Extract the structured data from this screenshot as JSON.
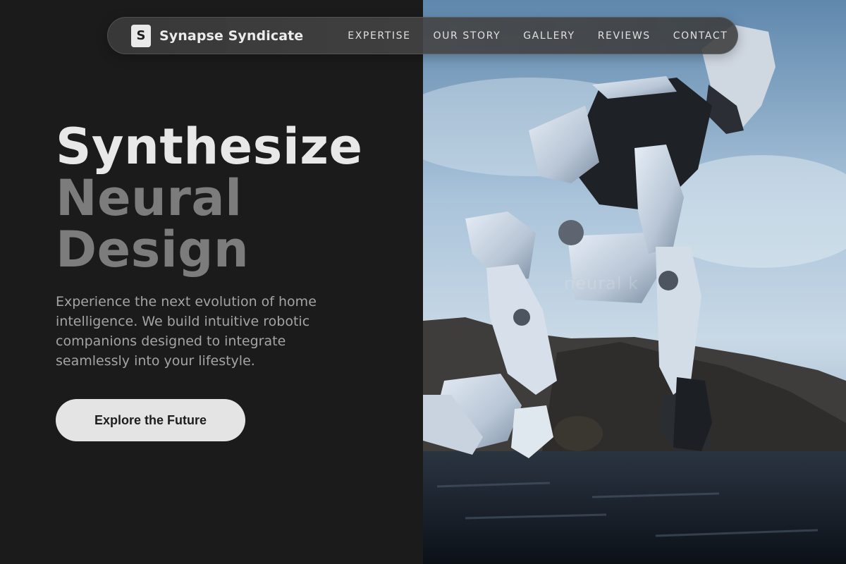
{
  "nav": {
    "brand_logo_letter": "S",
    "brand_name": "Synapse Syndicate",
    "links": [
      "EXPERTISE",
      "OUR STORY",
      "GALLERY",
      "REVIEWS",
      "CONTACT"
    ]
  },
  "hero": {
    "headline_line1": "Synthesize",
    "headline_line2": "Neural",
    "headline_line3": "Design",
    "subtext": "Experience the next evolution of home intelligence. We build intuitive robotic companions designed to integrate seamlessly into your lifestyle.",
    "cta_label": "Explore the Future"
  },
  "image": {
    "subject": "robot-crouching-on-rocks-photo",
    "watermark": "neural k"
  },
  "colors": {
    "background": "#1b1b1b",
    "headline_primary": "#e8e8e8",
    "headline_muted": "#7c7c7c",
    "cta_bg": "#e4e4e4"
  }
}
